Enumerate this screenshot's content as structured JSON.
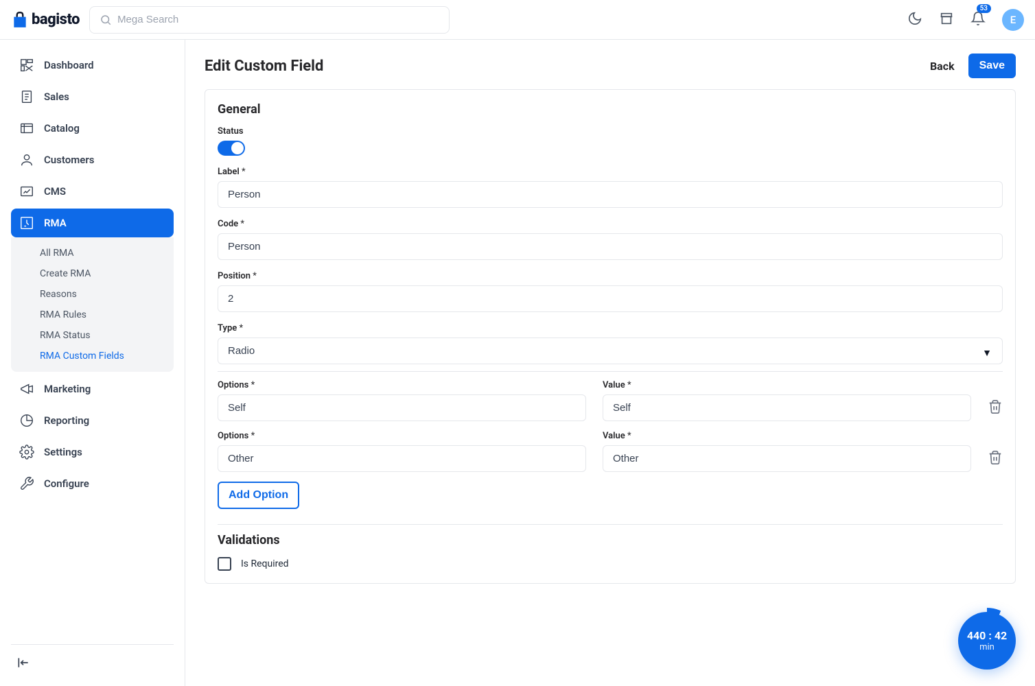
{
  "brand": "bagisto",
  "search": {
    "placeholder": "Mega Search"
  },
  "notifications": {
    "count": "53"
  },
  "user": {
    "initial": "E"
  },
  "sidebar": {
    "items": [
      {
        "label": "Dashboard"
      },
      {
        "label": "Sales"
      },
      {
        "label": "Catalog"
      },
      {
        "label": "Customers"
      },
      {
        "label": "CMS"
      },
      {
        "label": "RMA"
      },
      {
        "label": "Marketing"
      },
      {
        "label": "Reporting"
      },
      {
        "label": "Settings"
      },
      {
        "label": "Configure"
      }
    ],
    "rma_sub": [
      {
        "label": "All RMA"
      },
      {
        "label": "Create RMA"
      },
      {
        "label": "Reasons"
      },
      {
        "label": "RMA Rules"
      },
      {
        "label": "RMA Status"
      },
      {
        "label": "RMA Custom Fields"
      }
    ]
  },
  "page": {
    "title": "Edit Custom Field",
    "back": "Back",
    "save": "Save"
  },
  "sections": {
    "general": "General",
    "validations": "Validations"
  },
  "form": {
    "status_label": "Status",
    "label_label": "Label",
    "label_value": "Person",
    "code_label": "Code",
    "code_value": "Person",
    "position_label": "Position",
    "position_value": "2",
    "type_label": "Type",
    "type_value": "Radio",
    "options_label": "Options",
    "value_label": "Value",
    "option_rows": [
      {
        "option": "Self",
        "value": "Self"
      },
      {
        "option": "Other",
        "value": "Other"
      }
    ],
    "add_option": "Add Option",
    "is_required": "Is Required",
    "required_mark": "*"
  },
  "timer": {
    "time": "440 : 42",
    "unit": "min"
  }
}
